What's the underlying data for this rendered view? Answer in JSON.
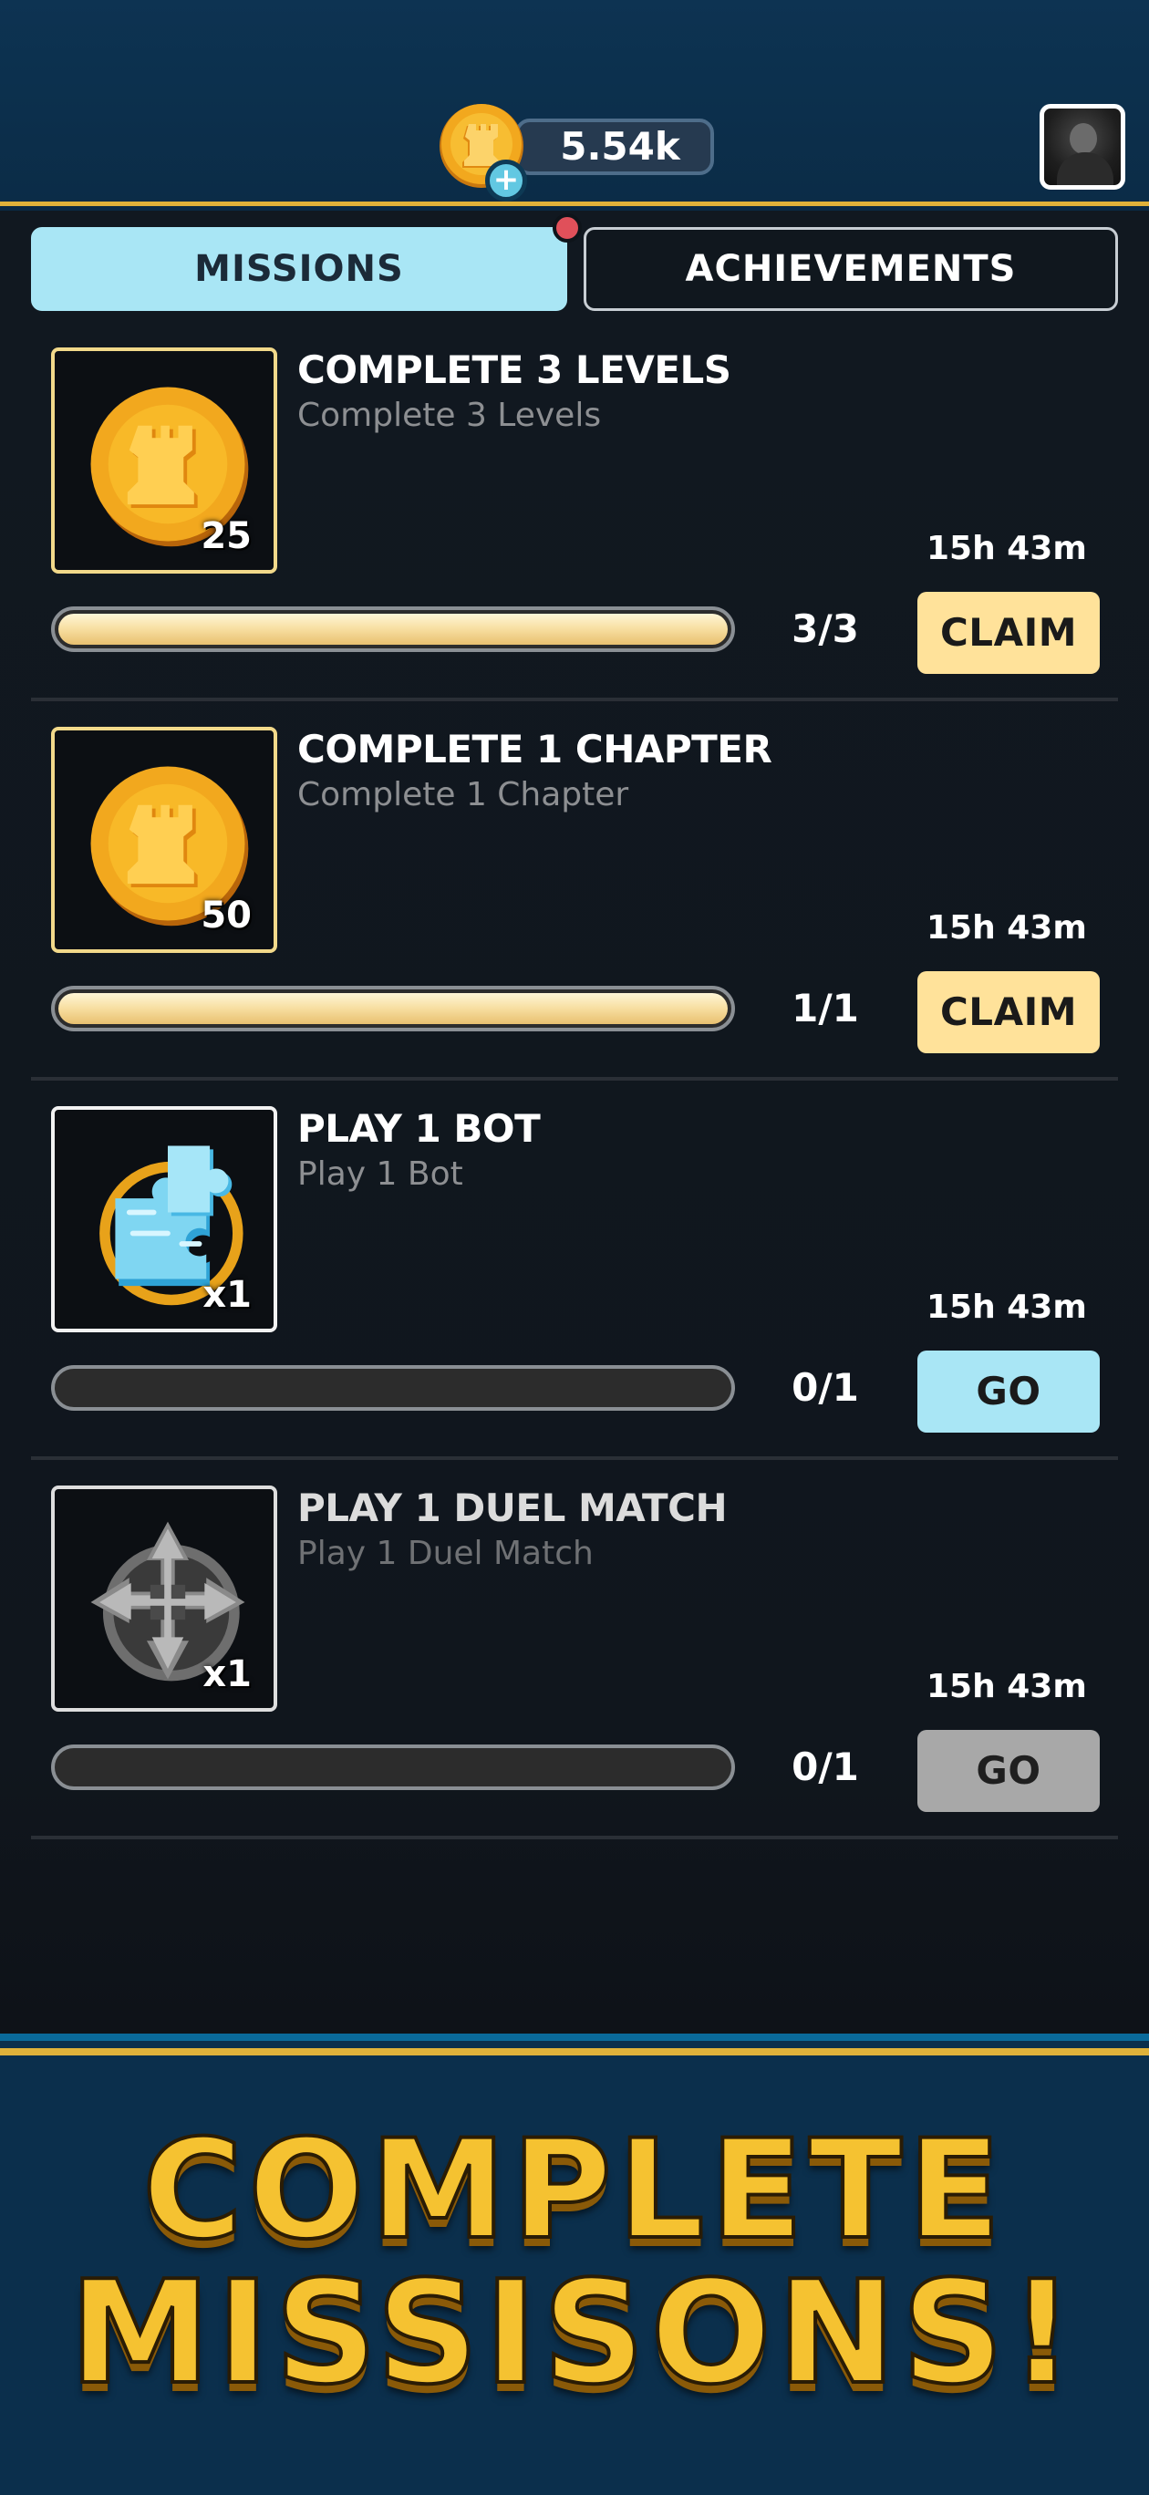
{
  "header": {
    "currency_value": "5.54k",
    "plus_label": "+",
    "currency_icon": "rook-coin-icon",
    "avatar": "profile-avatar"
  },
  "tabs": [
    {
      "label": "MISSIONS",
      "active": true
    },
    {
      "label": "ACHIEVEMENTS",
      "active": false
    }
  ],
  "missions": [
    {
      "title": "COMPLETE 3 LEVELS",
      "subtitle": "Complete 3 Levels",
      "reward_qty": "25",
      "reward_icon": "rook-coin-icon",
      "timer": "15h 43m",
      "progress": "3/3",
      "progress_fraction": 1.0,
      "button": "CLAIM"
    },
    {
      "title": "COMPLETE 1 CHAPTER",
      "subtitle": "Complete 1 Chapter",
      "reward_qty": "50",
      "reward_icon": "rook-coin-icon",
      "timer": "15h 43m",
      "progress": "1/1",
      "progress_fraction": 1.0,
      "button": "CLAIM"
    },
    {
      "title": "PLAY 1 BOT",
      "subtitle": "Play 1 Bot",
      "reward_qty": "x1",
      "reward_icon": "puzzle-piece-icon",
      "timer": "15h 43m",
      "progress": "0/1",
      "progress_fraction": 0.0,
      "button": "GO"
    },
    {
      "title": "PLAY 1 DUEL MATCH",
      "subtitle": "Play 1 Duel Match",
      "reward_qty": "x1",
      "reward_icon": "crossed-arrows-icon",
      "timer": "15h 43m",
      "progress": "0/1",
      "progress_fraction": 0.0,
      "button": "GO"
    }
  ],
  "banner": {
    "line1": "COMPLETE",
    "line2": "MISSISONS!"
  },
  "colors": {
    "header_bg": "#0b2c47",
    "gold_accent": "#e0b23a",
    "active_tab": "#a9e6f5",
    "claim_button": "#ffe29a",
    "go_button": "#a9e6f5",
    "go_disabled": "#a8a8a8",
    "banner_text": "#f5c231"
  }
}
